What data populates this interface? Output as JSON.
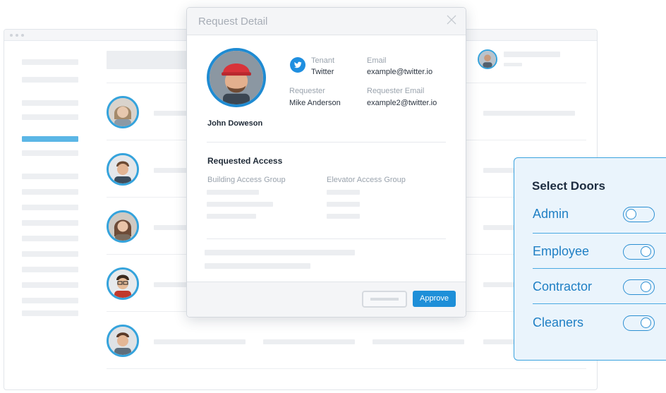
{
  "modal": {
    "title": "Request Detail",
    "profile_name": "John Doweson",
    "tenant_label": "Tenant",
    "tenant_value": "Twitter",
    "email_label": "Email",
    "email_value": "example@twitter.io",
    "requester_label": "Requester",
    "requester_value": "Mike Anderson",
    "requester_email_label": "Requester Email",
    "requester_email_value": "example2@twitter.io",
    "requested_access_title": "Requested Access",
    "building_group_label": "Building Access Group",
    "elevator_group_label": "Elevator Access Group",
    "approve_label": "Approve"
  },
  "doors": {
    "title": "Select Doors",
    "items": [
      {
        "label": "Admin",
        "enabled": false
      },
      {
        "label": "Employee",
        "enabled": true
      },
      {
        "label": "Contractor",
        "enabled": true
      },
      {
        "label": "Cleaners",
        "enabled": true
      }
    ]
  },
  "colors": {
    "accent": "#1e8fd8",
    "avatar_ring": "#35a3dc",
    "active_nav": "#5bb6e6",
    "panel_bg": "#eaf4fc"
  },
  "icons": {
    "tenant": "twitter-bird-icon",
    "close": "close-icon"
  }
}
